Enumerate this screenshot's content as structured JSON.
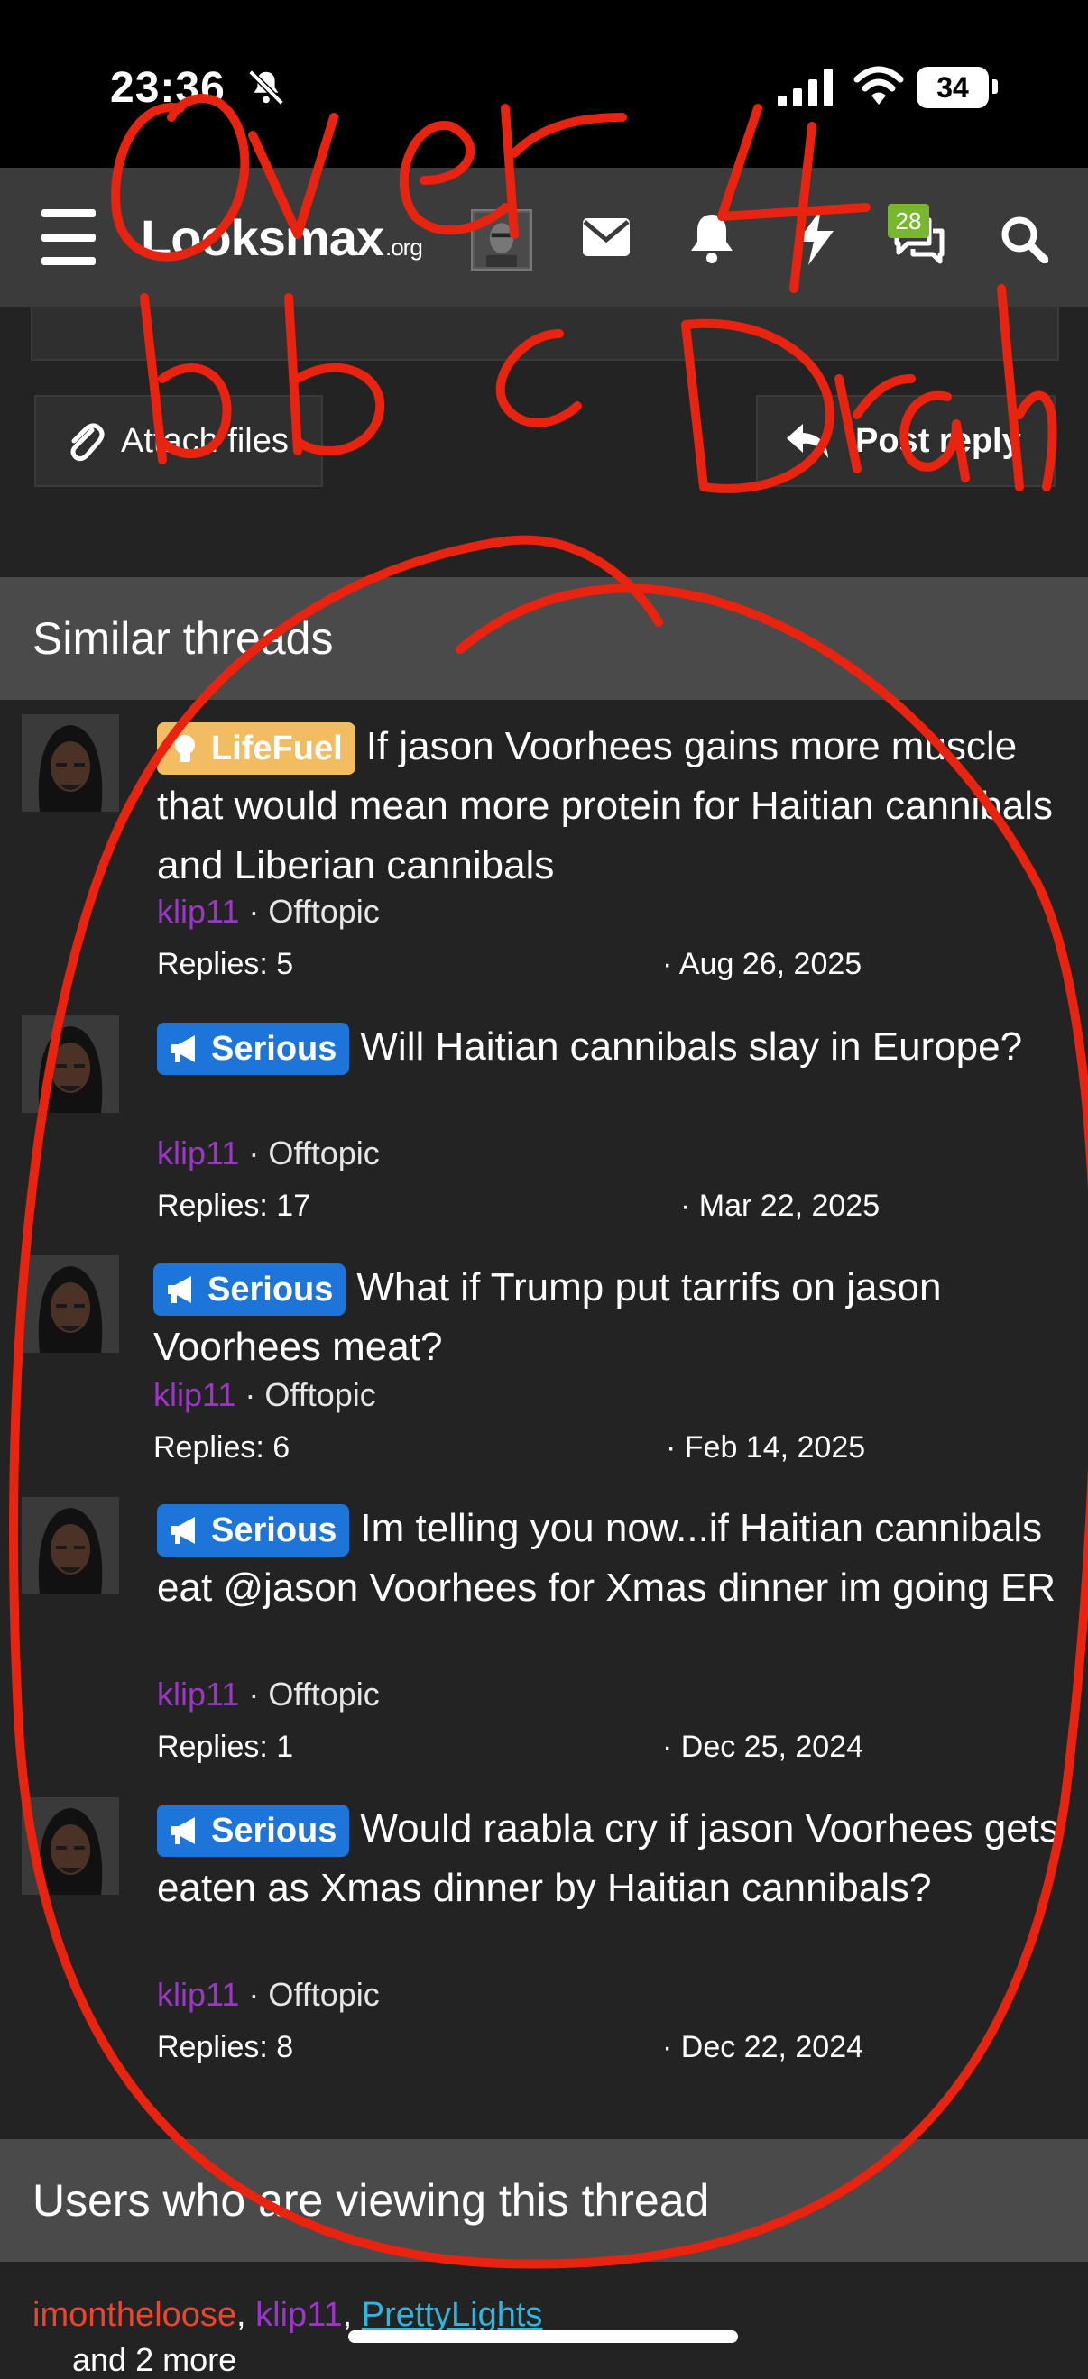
{
  "status_bar": {
    "time": "23:36",
    "battery": "34"
  },
  "nav": {
    "logo_main": "Looksmax",
    "logo_suffix": ".org",
    "chat_badge": "28",
    "icons": [
      "menu-icon",
      "avatar",
      "envelope-icon",
      "bell-icon",
      "bolt-icon",
      "chat-icon",
      "search-icon"
    ]
  },
  "editor": {
    "attach_label": "Attach files",
    "post_reply_label": "Post reply"
  },
  "similar_threads": {
    "heading": "Similar threads",
    "threads": [
      {
        "prefix": "LifeFuel",
        "title": "If jason Voorhees gains more muscle that would mean more protein for Haitian cannibals and Liberian cannibals",
        "author": "klip11",
        "forum": "· Offtopic",
        "replies": "Replies: 5",
        "date": "· Aug 26, 2025"
      },
      {
        "prefix": "Serious",
        "title": "Will Haitian cannibals slay in Europe?",
        "author": "klip11",
        "forum": "· Offtopic",
        "replies": "Replies: 17",
        "date": "· Mar 22, 2025"
      },
      {
        "prefix": "Serious",
        "title": "What if Trump put tarrifs on jason Voorhees meat?",
        "author": "klip11",
        "forum": "· Offtopic",
        "replies": "Replies: 6",
        "date": "· Feb 14, 2025"
      },
      {
        "prefix": "Serious",
        "title": "Im telling you now...if Haitian cannibals eat @jason Voorhees for Xmas dinner im going ER",
        "author": "klip11",
        "forum": "· Offtopic",
        "replies": "Replies: 1",
        "date": "· Dec 25, 2024"
      },
      {
        "prefix": "Serious",
        "title": "Would raabla cry if jason Voorhees gets eaten as Xmas dinner by Haitian cannibals?",
        "author": "klip11",
        "forum": "· Offtopic",
        "replies": "Replies: 8",
        "date": "· Dec 22, 2024"
      }
    ]
  },
  "viewing": {
    "heading": "Users who are viewing this thread",
    "users": [
      "imontheloose",
      "klip11",
      "PrettyLights"
    ],
    "more": "and 2 more"
  },
  "annotation": {
    "text": "Over 4 bbc Drah",
    "color": "#e8230f"
  },
  "colors": {
    "serious": "#1d74d9",
    "lifefuel": "#f2bd62",
    "username": "#9b36c8",
    "badge": "#7ab730"
  }
}
